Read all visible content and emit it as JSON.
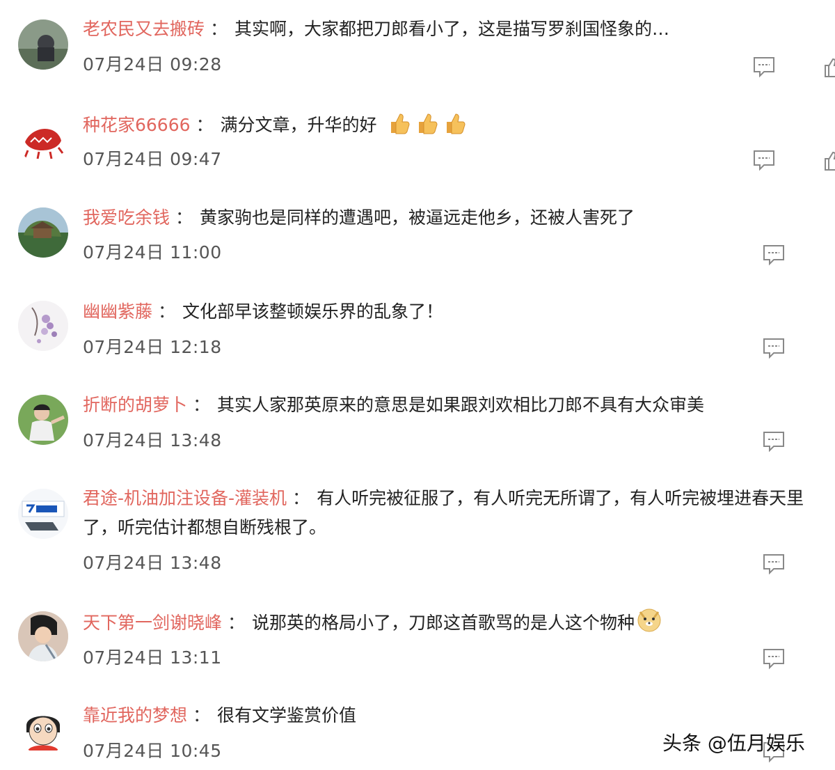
{
  "comments": [
    {
      "user": "老农民又去搬砖",
      "text": "其实啊，大家都把刀郎看小了，这是描写罗刹国怪象的…",
      "time": "07月24日 09:28"
    },
    {
      "user": "种花家66666",
      "text": "满分文章，升华的好",
      "time": "07月24日 09:47",
      "emoji": "thumbs-up-emoji"
    },
    {
      "user": "我爱吃余钱",
      "text": "黄家驹也是同样的遭遇吧，被逼远走他乡，还被人害死了",
      "time": "07月24日 11:00"
    },
    {
      "user": "幽幽紫藤",
      "text": "文化部早该整顿娱乐界的乱象了！",
      "time": "07月24日 12:18"
    },
    {
      "user": "折断的胡萝卜",
      "text": "其实人家那英原来的意思是如果跟刘欢相比刀郎不具有大众审美",
      "time": "07月24日 13:48"
    },
    {
      "user": "君途-机油加注设备-灌装机",
      "text": "有人听完被征服了，有人听完无所谓了，有人听完被埋进春天里了，听完估计都想自断残根了。",
      "time": "07月24日 13:48"
    },
    {
      "user": "天下第一剑谢晓峰",
      "text": "说那英的格局小了，刀郎这首歌骂的是人这个物种",
      "time": "07月24日 13:11",
      "emoji": "doge-emoji"
    },
    {
      "user": "靠近我的梦想",
      "text": "很有文学鉴赏价值",
      "time": "07月24日 10:45"
    }
  ],
  "separator": "：",
  "watermark": "头条 @伍月娱乐",
  "colors": {
    "username": "#e1665e",
    "text": "#222222",
    "time": "#555555",
    "icon": "#888888"
  }
}
